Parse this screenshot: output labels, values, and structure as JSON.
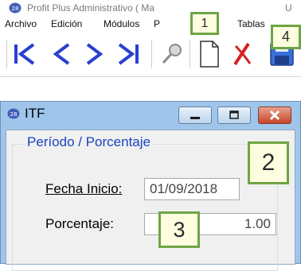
{
  "app": {
    "title": "Profit Plus Administrativo ( Ma",
    "title_right": "U"
  },
  "menu": {
    "items": [
      "Archivo",
      "Edición",
      "Módulos",
      "P",
      "Tablas"
    ]
  },
  "toolbar": {
    "buttons": [
      "first-record",
      "previous-record",
      "next-record",
      "last-record",
      "search",
      "new",
      "delete",
      "save"
    ]
  },
  "callouts": [
    "1",
    "2",
    "3",
    "4"
  ],
  "dialog": {
    "title": "ITF",
    "group_title": "Período / Porcentaje",
    "fecha_label": "Fecha Inicio:",
    "fecha_value": "01/09/2018",
    "porcentaje_label": "Porcentaje:",
    "porcentaje_value": "1.00"
  },
  "colors": {
    "dialog_frame": "#9fc6ea",
    "group_title": "#1a43c0",
    "callout_border": "#6ea544",
    "callout_fill": "#fffde0",
    "nav_arrows": "#2a3fd0",
    "delete_x": "#d62020",
    "save_disk": "#3a6fd8"
  }
}
